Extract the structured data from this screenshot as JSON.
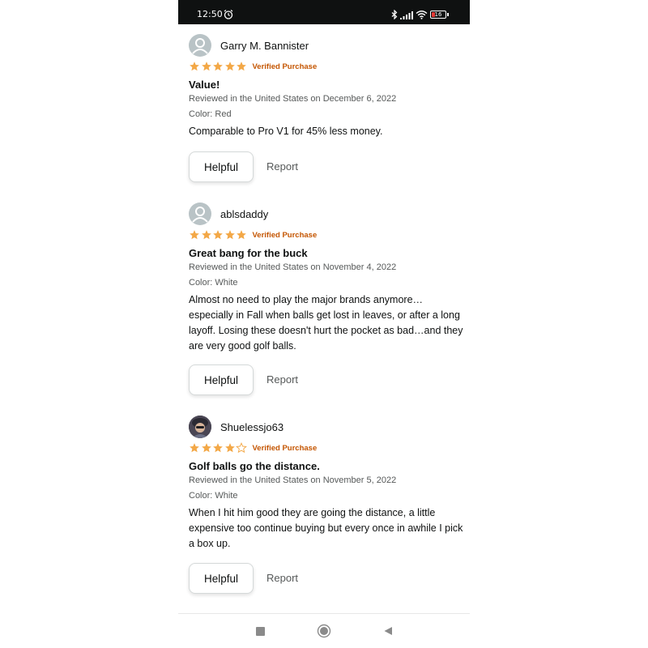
{
  "status_bar": {
    "time": "12:50",
    "battery_level": "16",
    "icons": [
      "alarm-icon",
      "bluetooth-icon",
      "signal-icon",
      "wifi-icon",
      "battery-icon"
    ],
    "battery_color": "#e53935"
  },
  "colors": {
    "star": "#f3a847",
    "verified": "#c45500",
    "status_bar_bg": "#0f1111"
  },
  "reviews": [
    {
      "reviewer": "Garry M. Bannister",
      "rating": 5,
      "verified_label": "Verified Purchase",
      "title": "Value!",
      "date_line": "Reviewed in the United States on December 6, 2022",
      "variant": "Color: Red",
      "body": "Comparable to Pro V1 for 45% less money.",
      "helpful_label": "Helpful",
      "report_label": "Report"
    },
    {
      "reviewer": "ablsdaddy",
      "rating": 5,
      "verified_label": "Verified Purchase",
      "title": "Great bang for the buck",
      "date_line": "Reviewed in the United States on November 4, 2022",
      "variant": "Color: White",
      "body": "Almost no need to play the major brands anymore… especially in Fall when balls get lost in leaves, or after a long layoff. Losing these doesn't hurt the pocket as bad…and they are very good golf balls.",
      "helpful_label": "Helpful",
      "report_label": "Report"
    },
    {
      "reviewer": "Shuelessjo63",
      "rating": 4,
      "verified_label": "Verified Purchase",
      "title": "Golf balls go the distance.",
      "date_line": "Reviewed in the United States on November 5, 2022",
      "variant": "Color: White",
      "body": "When I hit him good they are going the distance, a little expensive too continue buying but every once in awhile I pick a box up.",
      "helpful_label": "Helpful",
      "report_label": "Report"
    }
  ],
  "nav_bar": {
    "icons": [
      "recents-square-icon",
      "home-circle-icon",
      "back-triangle-icon"
    ]
  }
}
